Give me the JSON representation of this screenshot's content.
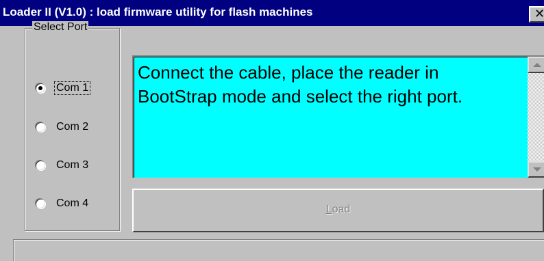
{
  "window": {
    "title": "Loader II (V1.0) : load firmware utility for flash machines",
    "close_glyph": "✕"
  },
  "port_group": {
    "label": "Select Port",
    "options": [
      {
        "label": "Com 1",
        "checked": true
      },
      {
        "label": "Com 2",
        "checked": false
      },
      {
        "label": "Com 3",
        "checked": false
      },
      {
        "label": "Com 4",
        "checked": false
      }
    ]
  },
  "message": {
    "text": "Connect the cable, place the reader in BootStrap mode and select the right port.",
    "background": "#00ffff"
  },
  "load_button": {
    "mnemonic": "L",
    "label_rest": "oad",
    "enabled": false
  },
  "status": {
    "text": ""
  },
  "colors": {
    "titlebar": "#000080",
    "face": "#c0c0c0"
  }
}
